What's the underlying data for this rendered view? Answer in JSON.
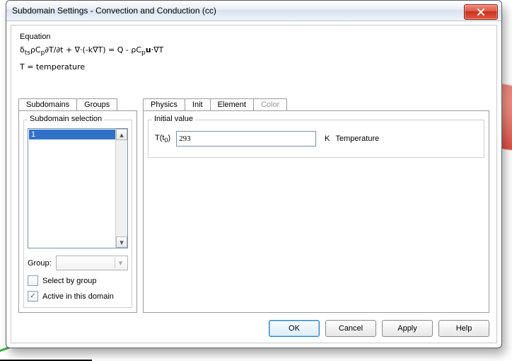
{
  "window": {
    "title": "Subdomain Settings - Convection and Conduction (cc)"
  },
  "equation": {
    "label": "Equation",
    "line1_html": "δ<sub>ts</sub>ρC<sub>p</sub>∂T/∂t + ∇·(-k∇T) = Q - ρC<sub>p</sub><span class='bold'>u</span>·∇T",
    "line2": "T = temperature"
  },
  "left_tabs": {
    "subdomains": "Subdomains",
    "groups": "Groups",
    "active": "subdomains"
  },
  "subdomain_panel": {
    "title": "Subdomain selection",
    "items": [
      "1"
    ],
    "selected_index": 0,
    "group_label": "Group:",
    "group_value": "",
    "select_by_group_label": "Select by group",
    "select_by_group_checked": false,
    "active_in_domain_label": "Active in this domain",
    "active_in_domain_checked": true
  },
  "right_tabs": {
    "physics": "Physics",
    "init": "Init",
    "element": "Element",
    "color": "Color",
    "active": "init"
  },
  "init_panel": {
    "title": "Initial value",
    "field_label_html": "T(t<sub>0</sub>)",
    "value": "293",
    "unit": "K",
    "description": "Temperature"
  },
  "buttons": {
    "ok": "OK",
    "cancel": "Cancel",
    "apply": "Apply",
    "help": "Help"
  }
}
